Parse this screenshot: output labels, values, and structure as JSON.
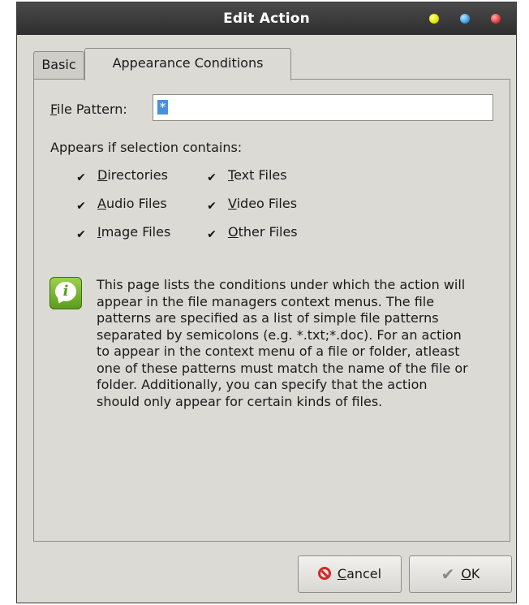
{
  "window": {
    "title": "Edit Action"
  },
  "tabs": [
    {
      "label": "Basic",
      "active": false
    },
    {
      "label": "Appearance Conditions",
      "active": true
    }
  ],
  "file_pattern": {
    "label_mnemonic": "F",
    "label_rest": "ile Pattern:",
    "value": "*"
  },
  "appears_label": "Appears if selection contains:",
  "checkboxes": [
    {
      "mnemonic": "D",
      "rest": "irectories",
      "checked": true
    },
    {
      "mnemonic": "T",
      "rest": "ext Files",
      "checked": true
    },
    {
      "mnemonic": "A",
      "rest": "udio Files",
      "checked": true
    },
    {
      "mnemonic": "V",
      "rest": "ideo Files",
      "checked": true
    },
    {
      "mnemonic": "I",
      "rest": "mage Files",
      "checked": true
    },
    {
      "mnemonic": "O",
      "rest": "ther Files",
      "checked": true
    }
  ],
  "check_glyph": "✔",
  "info": {
    "icon": "info-icon",
    "text": "This page lists the conditions under which the action will appear in the file managers context menus. The file patterns are specified as a list of simple file patterns separated by semicolons (e.g. *.txt;*.doc). For an action to appear in the context menu of a file or folder, atleast one of these patterns must match the name of the file or folder. Additionally, you can specify that the action should only appear for certain kinds of files."
  },
  "buttons": {
    "cancel": {
      "mnemonic": "C",
      "rest": "ancel",
      "icon": "cancel-icon"
    },
    "ok": {
      "mnemonic": "O",
      "rest": "K",
      "icon": "checkmark-icon"
    }
  },
  "colors": {
    "titlebar": "#2e2e2e",
    "dialog_bg": "#dcdad5",
    "selection": "#4a90d9",
    "info_green": "#5a9a1e",
    "cancel_red": "#d22a2a"
  }
}
